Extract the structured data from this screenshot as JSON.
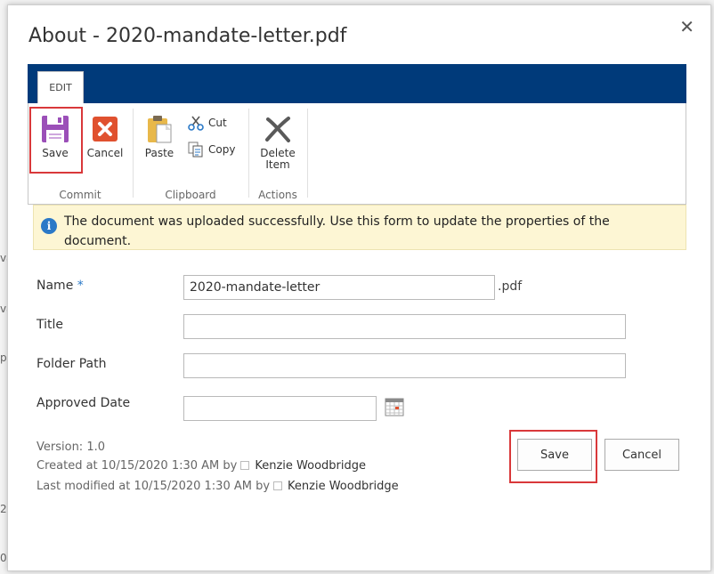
{
  "background": {
    "fragments": [
      "va",
      "va",
      "p",
      "2",
      "0"
    ]
  },
  "dialog": {
    "title": "About - 2020-mandate-letter.pdf",
    "close_icon": "close-icon"
  },
  "ribbon": {
    "tab_label": "EDIT",
    "groups": {
      "commit": {
        "label": "Commit",
        "save_label": "Save",
        "cancel_label": "Cancel"
      },
      "clipboard": {
        "label": "Clipboard",
        "paste_label": "Paste",
        "cut_label": "Cut",
        "copy_label": "Copy"
      },
      "actions": {
        "label": "Actions",
        "delete_label_line1": "Delete",
        "delete_label_line2": "Item"
      }
    },
    "colors": {
      "bar": "#003a7a",
      "save_icon": "#9b4fb8",
      "cancel_icon": "#e0512f",
      "highlight": "#d9383a"
    }
  },
  "message": {
    "icon": "info-icon",
    "text": "The document was uploaded successfully. Use this form to update the properties of the document."
  },
  "form": {
    "name": {
      "label": "Name",
      "required_mark": "*",
      "value": "2020-mandate-letter",
      "suffix": ".pdf"
    },
    "title": {
      "label": "Title",
      "value": ""
    },
    "folder_path": {
      "label": "Folder Path",
      "value": ""
    },
    "approved_date": {
      "label": "Approved Date",
      "value": "",
      "icon": "calendar-icon"
    }
  },
  "meta": {
    "version": "Version: 1.0",
    "created_prefix": "Created at 10/15/2020 1:30 AM  by",
    "created_by": "Kenzie Woodbridge",
    "modified_prefix": "Last modified at 10/15/2020 1:30 AM  by",
    "modified_by": "Kenzie Woodbridge"
  },
  "buttons": {
    "save": "Save",
    "cancel": "Cancel"
  }
}
